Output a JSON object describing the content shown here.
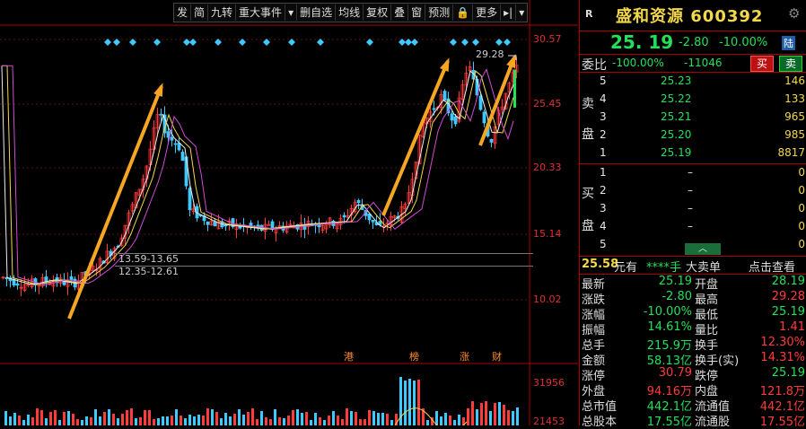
{
  "toolbar": {
    "items": [
      "发",
      "简",
      "九转",
      "重大事件",
      "▾",
      "删自选",
      "均线",
      "复权",
      "叠",
      "窗",
      "预测",
      "🔒",
      "更多",
      "▸|",
      "▾"
    ]
  },
  "price_axis": {
    "labels": [
      "30.57",
      "25.45",
      "20.33",
      "15.14",
      "10.02",
      "31956",
      "21453"
    ]
  },
  "annotations": {
    "range1": "13.59-13.65",
    "range2": "12.35-12.61",
    "high_label": "29.28",
    "event_markers": [
      "港",
      "榜",
      "涨",
      "财"
    ]
  },
  "colors": {
    "up": "#ff3b3b",
    "down": "#22e05a",
    "accent": "#f5a623",
    "blue": "#3ec9ff"
  },
  "stock": {
    "r_badge": "R",
    "name_code": "盛和资源 600392",
    "price": "25. 19",
    "change": "-2.80",
    "change_pct": "-10.00%",
    "market_tag": "陆"
  },
  "ratio": {
    "label": "委比",
    "pct": "-100.00%",
    "value": "-11046",
    "buy_btn": "买",
    "sell_btn": "卖"
  },
  "sell_side": {
    "label_top": "卖",
    "label_bottom": "盘",
    "rows": [
      {
        "lvl": "5",
        "price": "25.23",
        "vol": "146"
      },
      {
        "lvl": "4",
        "price": "25.22",
        "vol": "133"
      },
      {
        "lvl": "3",
        "price": "25.21",
        "vol": "965"
      },
      {
        "lvl": "2",
        "price": "25.20",
        "vol": "985"
      },
      {
        "lvl": "1",
        "price": "25.19",
        "vol": "8817"
      }
    ]
  },
  "buy_side": {
    "label_top": "买",
    "label_bottom": "盘",
    "rows": [
      {
        "lvl": "1",
        "price": "–",
        "vol": "0"
      },
      {
        "lvl": "2",
        "price": "–",
        "vol": "0"
      },
      {
        "lvl": "3",
        "price": "–",
        "vol": "0"
      },
      {
        "lvl": "4",
        "price": "–",
        "vol": "0"
      },
      {
        "lvl": "5",
        "price": "–",
        "vol": "0"
      }
    ]
  },
  "big_order": {
    "price": "25.58",
    "unit": "元有",
    "hands": "****手",
    "label": "大卖单",
    "link": "点击查看"
  },
  "stats": [
    {
      "l": "最新",
      "v": "25.19",
      "l2": "开盘",
      "v2": "28.19"
    },
    {
      "l": "涨跌",
      "v": "-2.80",
      "l2": "最高",
      "v2": "29.28"
    },
    {
      "l": "涨幅",
      "v": "-10.00%",
      "l2": "最低",
      "v2": "25.19"
    },
    {
      "l": "振幅",
      "v": "14.61%",
      "l2": "量比",
      "v2": "1.41"
    },
    {
      "l": "总手",
      "v": "215.9万",
      "l2": "换手",
      "v2": "12.30%"
    },
    {
      "l": "金额",
      "v": "58.13亿",
      "l2": "换手(实)",
      "v2": "14.31%"
    },
    {
      "l": "涨停",
      "v": "30.79",
      "l2": "跌停",
      "v2": "25.19"
    },
    {
      "l": "外盘",
      "v": "94.16万",
      "l2": "内盘",
      "v2": "121.8万"
    },
    {
      "l": "总市值",
      "v": "442.1亿",
      "l2": "流通值",
      "v2": "442.1亿"
    },
    {
      "l": "总股本",
      "v": "17.55亿",
      "l2": "流通股",
      "v2": "17.55亿"
    }
  ]
}
